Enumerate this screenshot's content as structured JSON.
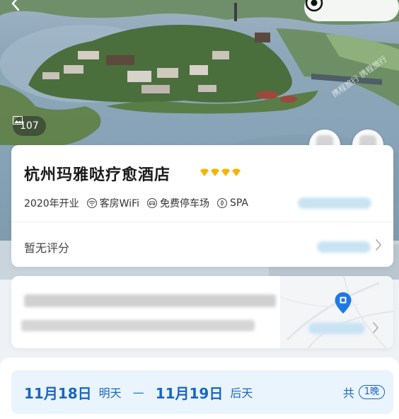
{
  "hero": {
    "photo_count": "107",
    "watermark": "携程旅行 携程旅行"
  },
  "hotel": {
    "name": "杭州玛雅哒疗愈酒店",
    "diamond_count": 4,
    "diamond_color": "#f5b400",
    "opened": "2020年开业",
    "facilities": [
      {
        "icon": "wifi-icon",
        "label": "客房WiFi"
      },
      {
        "icon": "parking-icon",
        "label": "免费停车场"
      },
      {
        "icon": "spa-icon",
        "label": "SPA"
      }
    ]
  },
  "rating": {
    "label": "暂无评分"
  },
  "stay": {
    "checkin_date": "11月18日",
    "checkin_day": "明天",
    "separator": "—",
    "checkout_date": "11月19日",
    "checkout_day": "后天",
    "total_prefix": "共",
    "nights": "1晚"
  },
  "colors": {
    "accent": "#1a66c2",
    "date_bg": "#eaf4fd",
    "page_bg": "#eef1f5"
  }
}
